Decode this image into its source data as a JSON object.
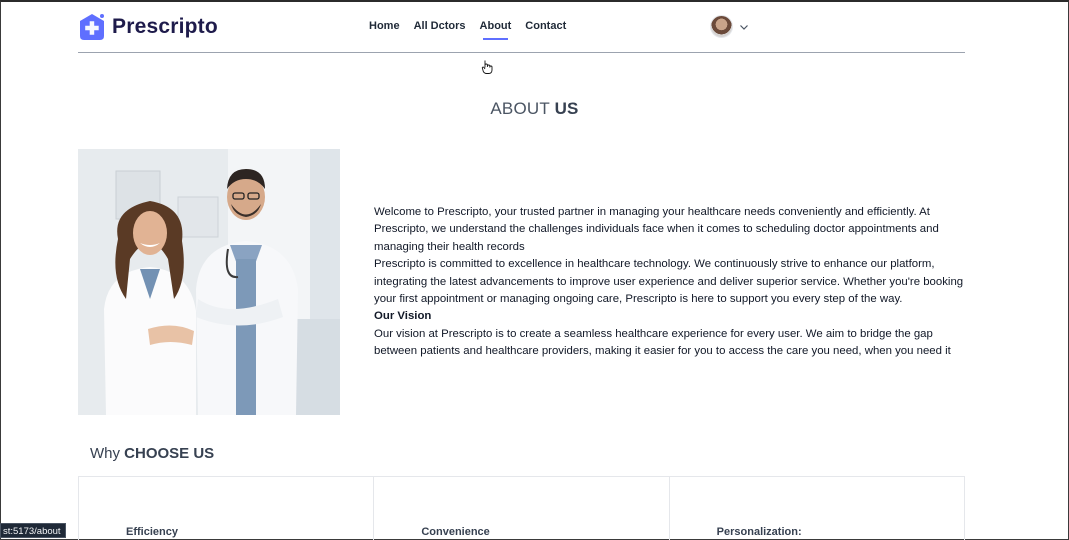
{
  "brand": {
    "name": "Prescripto",
    "accent": "#5f6fff"
  },
  "nav": {
    "items": [
      {
        "label": "Home"
      },
      {
        "label": "All Dctors"
      },
      {
        "label": "About",
        "active": true
      },
      {
        "label": "Contact"
      }
    ],
    "profile_icon": "avatar",
    "dropdown_icon": "chevron-down-icon"
  },
  "about": {
    "title_prefix": "ABOUT ",
    "title_bold": "US",
    "image_alt": "Two smiling doctors",
    "para1": "Welcome to Prescripto, your trusted partner in managing your healthcare needs conveniently and efficiently. At Prescripto, we understand the challenges individuals face when it comes to scheduling doctor appointments and managing their health records",
    "para2": "Prescripto is committed to excellence in healthcare technology. We continuously strive to enhance our platform, integrating the latest advancements to improve user experience and deliver superior service. Whether you're booking your first appointment or managing ongoing care, Prescripto is here to support you every step of the way.",
    "vision_heading": "Our Vision",
    "vision_text": "Our vision at Prescripto is to create a seamless healthcare experience for every user. We aim to bridge the gap between patients and healthcare providers, making it easier for you to access the care you need, when you need it"
  },
  "why": {
    "prefix": "Why ",
    "bold": "CHOOSE US",
    "cards": [
      {
        "title": "Efficiency"
      },
      {
        "title": "Convenience"
      },
      {
        "title": "Personalization:"
      }
    ]
  },
  "status_bar": {
    "url": "st:5173/about"
  }
}
